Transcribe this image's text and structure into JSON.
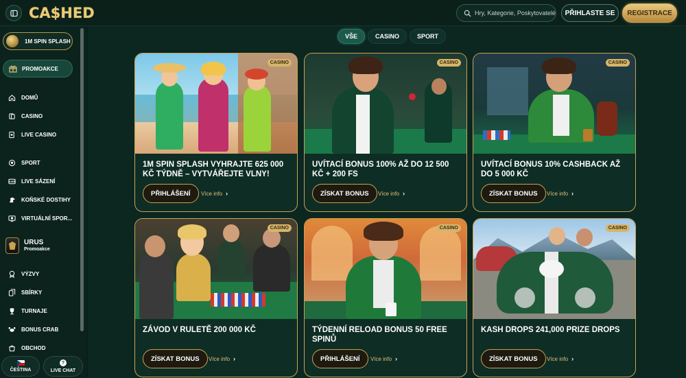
{
  "header": {
    "logo_text": "CA$HED",
    "search": {
      "placeholder": "Hry, Kategorie, Poskytovatelé"
    },
    "login_label": "Přihlaste se",
    "register_label": "Registrace"
  },
  "sidebar": {
    "spin_label": "1M Spin Splash",
    "promo_label": "Promoakce",
    "items": [
      {
        "label": "Domů",
        "icon": "home-icon"
      },
      {
        "label": "Casino",
        "icon": "cards-icon"
      },
      {
        "label": "Live Casino",
        "icon": "live-casino-icon"
      },
      {
        "label": "Sport",
        "icon": "ball-icon"
      },
      {
        "label": "Live sázení",
        "icon": "live-icon"
      },
      {
        "label": "Koňské dostihy",
        "icon": "horse-icon"
      },
      {
        "label": "Virtuální spor...",
        "icon": "virtual-sport-icon"
      },
      {
        "label": "Výzvy",
        "icon": "challenge-icon"
      },
      {
        "label": "Sbírky",
        "icon": "collection-icon"
      },
      {
        "label": "Turnaje",
        "icon": "trophy-icon"
      },
      {
        "label": "Bonus Crab",
        "icon": "crab-icon"
      },
      {
        "label": "Obchod",
        "icon": "shop-icon"
      }
    ],
    "urus": {
      "title": "URUS",
      "subtitle": "Promoakce"
    },
    "language_label": "Čeština",
    "chat_label": "Live Chat"
  },
  "tabs": [
    "Vše",
    "Casino",
    "Sport"
  ],
  "active_tab": "Vše",
  "cards": [
    {
      "tag": "Casino",
      "title": "1M Spin Splash vyhrajte 625 000 Kč týdně – vytvářejte vlny!",
      "cta": "Přihlášení",
      "more": "Více info"
    },
    {
      "tag": "Casino",
      "title": "Uvítací bonus 100% až do 12 500 Kč + 200 FS",
      "cta": "Získat bonus",
      "more": "Více info"
    },
    {
      "tag": "Casino",
      "title": "Uvítací bonus 10% Cashback až do 5 000 Kč",
      "cta": "Získat bonus",
      "more": "Více info"
    },
    {
      "tag": "Casino",
      "title": "Závod v ruletě 200 000 Kč",
      "cta": "Získat bonus",
      "more": "Více info"
    },
    {
      "tag": "Casino",
      "title": "Týdenní Reload Bonus 50 Free Spinů",
      "cta": "Přihlášení",
      "more": "Více info"
    },
    {
      "tag": "Casino",
      "title": "Kash Drops 241,000 Prize Drops",
      "cta": "Získat bonus",
      "more": "Více info"
    }
  ],
  "colors": {
    "gold": "#c9a454",
    "background": "#0c2620",
    "tag": "#d6b56b"
  }
}
